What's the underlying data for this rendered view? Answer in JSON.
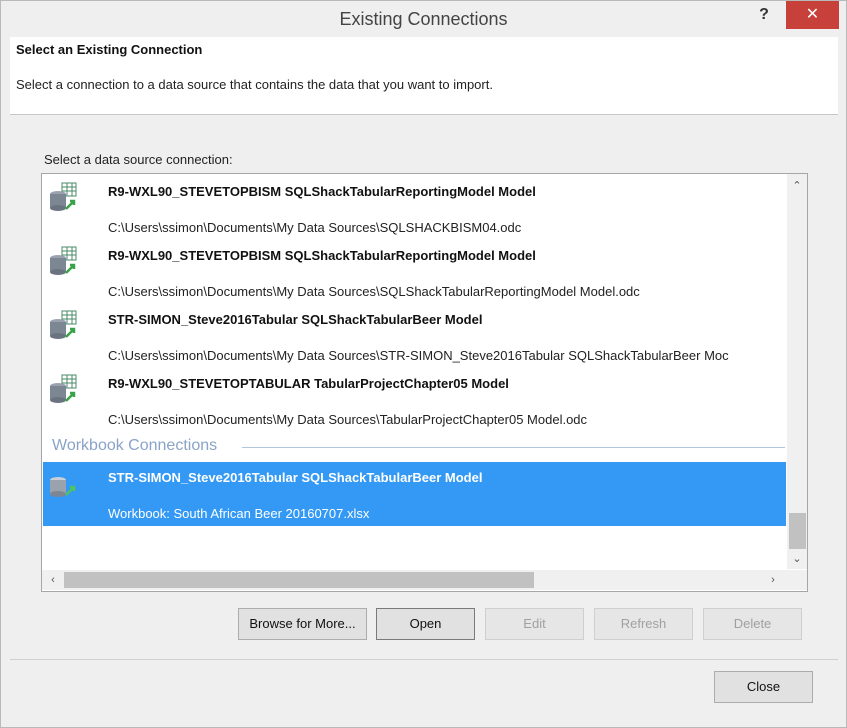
{
  "window": {
    "title": "Existing Connections",
    "help_label": "?",
    "close_label": "✕"
  },
  "header": {
    "title": "Select an Existing Connection",
    "description": "Select a connection to a data source that contains the data that you want to import."
  },
  "list": {
    "label": "Select a data source connection:",
    "connections": [
      {
        "name": "R9-WXL90_STEVETOPBISM SQLShackTabularReportingModel Model",
        "path": "C:\\Users\\ssimon\\Documents\\My Data Sources\\SQLSHACKBISM04.odc"
      },
      {
        "name": "R9-WXL90_STEVETOPBISM SQLShackTabularReportingModel Model",
        "path": "C:\\Users\\ssimon\\Documents\\My Data Sources\\SQLShackTabularReportingModel Model.odc"
      },
      {
        "name": "STR-SIMON_Steve2016Tabular SQLShackTabularBeer Model",
        "path": "C:\\Users\\ssimon\\Documents\\My Data Sources\\STR-SIMON_Steve2016Tabular SQLShackTabularBeer Moc"
      },
      {
        "name": "R9-WXL90_STEVETOPTABULAR TabularProjectChapter05 Model",
        "path": "C:\\Users\\ssimon\\Documents\\My Data Sources\\TabularProjectChapter05 Model.odc"
      }
    ],
    "section_heading": "Workbook Connections",
    "workbook_connections": [
      {
        "name": "STR-SIMON_Steve2016Tabular SQLShackTabularBeer Model",
        "path": "Workbook: South African Beer 20160707.xlsx",
        "selected": true
      }
    ]
  },
  "buttons": {
    "browse": "Browse for More...",
    "open": "Open",
    "edit": "Edit",
    "refresh": "Refresh",
    "delete": "Delete",
    "close": "Close"
  },
  "scroll": {
    "up": "⌃",
    "down": "⌄",
    "left": "‹",
    "right": "›"
  },
  "colors": {
    "selection": "#3399f5",
    "close_button": "#c7403a",
    "section_heading": "#8aa3c9"
  }
}
